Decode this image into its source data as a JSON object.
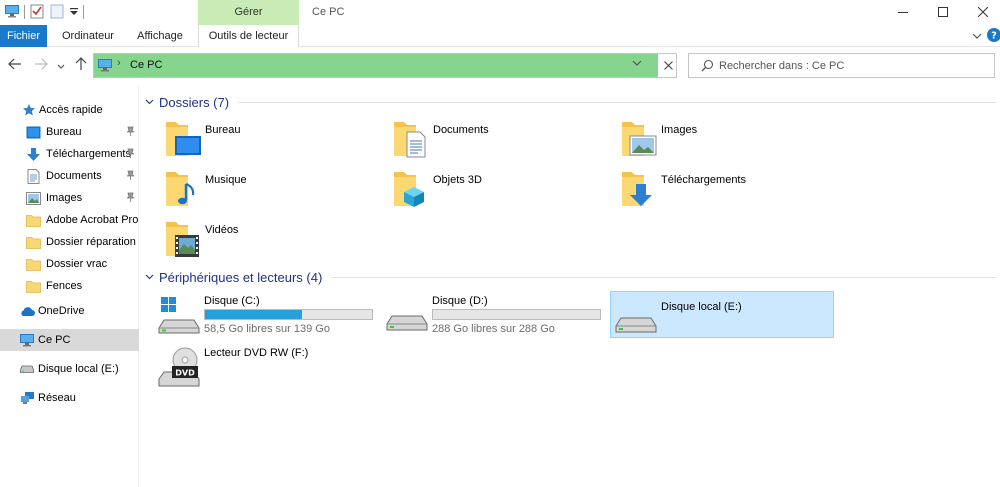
{
  "window": {
    "title": "Ce PC",
    "context_tab_group": "Gérer"
  },
  "ribbon": {
    "tabs": [
      {
        "label": "Fichier",
        "name": "file"
      },
      {
        "label": "Ordinateur",
        "name": "computer"
      },
      {
        "label": "Affichage",
        "name": "view"
      },
      {
        "label": "Outils de lecteur",
        "name": "drive-tools"
      }
    ]
  },
  "address": {
    "location": "Ce PC"
  },
  "search": {
    "placeholder": "Rechercher dans : Ce PC"
  },
  "nav": {
    "quick_access": "Accès rapide",
    "quick_items": [
      {
        "label": "Bureau",
        "icon": "desktop-icon",
        "pinned": true
      },
      {
        "label": "Téléchargements",
        "icon": "download-icon",
        "pinned": true
      },
      {
        "label": "Documents",
        "icon": "document-icon",
        "pinned": true
      },
      {
        "label": "Images",
        "icon": "image-icon",
        "pinned": true
      },
      {
        "label": "Adobe Acrobat Pro",
        "icon": "folder-icon",
        "pinned": false
      },
      {
        "label": "Dossier réparation P",
        "icon": "folder-icon",
        "pinned": false
      },
      {
        "label": "Dossier vrac",
        "icon": "folder-icon",
        "pinned": false
      },
      {
        "label": "Fences",
        "icon": "folder-icon",
        "pinned": false
      }
    ],
    "onedrive": "OneDrive",
    "this_pc": "Ce PC",
    "local_disk": "Disque local (E:)",
    "network": "Réseau"
  },
  "folders": {
    "heading": "Dossiers (7)",
    "items": [
      {
        "label": "Bureau",
        "overlay": "desktop"
      },
      {
        "label": "Documents",
        "overlay": "document"
      },
      {
        "label": "Images",
        "overlay": "image"
      },
      {
        "label": "Musique",
        "overlay": "music"
      },
      {
        "label": "Objets 3D",
        "overlay": "cube"
      },
      {
        "label": "Téléchargements",
        "overlay": "download"
      },
      {
        "label": "Vidéos",
        "overlay": "video"
      }
    ]
  },
  "devices": {
    "heading": "Périphériques et lecteurs (4)",
    "items": [
      {
        "label": "Disque  (C:)",
        "free": "58,5 Go libres sur 139 Go",
        "used_fraction": 0.58,
        "icon": "windows-drive-icon"
      },
      {
        "label": "Disque  (D:)",
        "free": "288 Go libres sur 288 Go",
        "used_fraction": 0.0,
        "icon": "drive-icon"
      },
      {
        "label": "Disque local (E:)",
        "icon": "drive-icon",
        "selected": true
      },
      {
        "label": "Lecteur DVD RW (F:)",
        "icon": "dvd-drive-icon"
      }
    ]
  },
  "colors": {
    "accent": "#1979ca",
    "address_highlight": "#86d58f",
    "context_tab": "#c9ecb6",
    "usage_bar": "#26a0da",
    "selection": "#cce8ff",
    "group_heading": "#1e3287"
  }
}
